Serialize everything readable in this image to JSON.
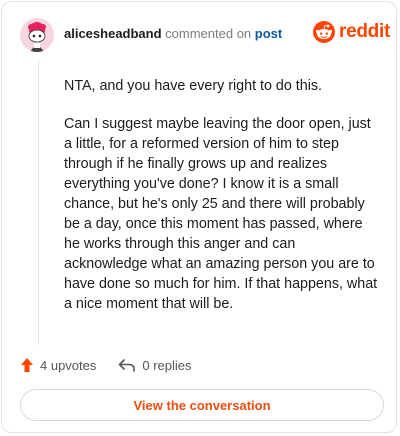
{
  "header": {
    "username": "alicesheadband",
    "action_text": "commented on",
    "post_link": "post",
    "brand": "reddit"
  },
  "comment": {
    "paragraphs": [
      "NTA, and you have every right to do this.",
      "Can I suggest maybe leaving the door open, just a little, for a reformed version of him to step through if he finally grows up and realizes everything you've done? I know it is a small chance, but he's only 25 and there will probably be a day, once this moment has passed, where he works through this anger and can acknowledge what an amazing person you are to have done so much for him. If that happens, what a nice moment that will be."
    ]
  },
  "actions": {
    "upvotes": "4 upvotes",
    "replies": "0 replies"
  },
  "view_button": "View the conversation",
  "colors": {
    "brand": "#ff4500",
    "link": "#0b5ca8",
    "button_text": "#ef4d0f"
  },
  "icons": {
    "avatar": "snoo-avatar",
    "logo": "reddit-alien-icon",
    "upvote": "upvote-arrow-icon",
    "reply": "reply-arrow-icon"
  }
}
